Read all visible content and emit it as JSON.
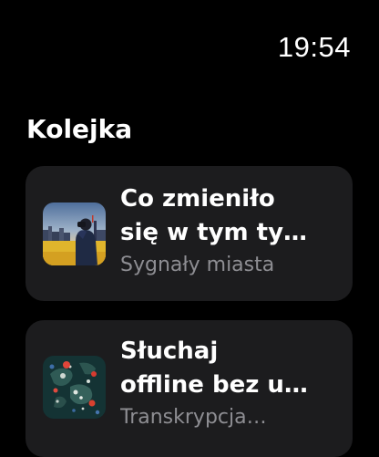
{
  "status_bar": {
    "time": "19:54"
  },
  "screen": {
    "title": "Kolejka"
  },
  "queue": [
    {
      "title_line1": "Co zmieniło",
      "title_line2": "się w tym ty…",
      "subtitle": "Sygnały miasta",
      "artwork": "city-photographer-artwork"
    },
    {
      "title_line1": "Słuchaj",
      "title_line2": "offline bez u…",
      "subtitle": "Transkrypcja…",
      "artwork": "abstract-map-artwork"
    }
  ],
  "colors": {
    "background": "#000000",
    "card": "#1c1c1e",
    "secondary_text": "#8e8e93"
  }
}
